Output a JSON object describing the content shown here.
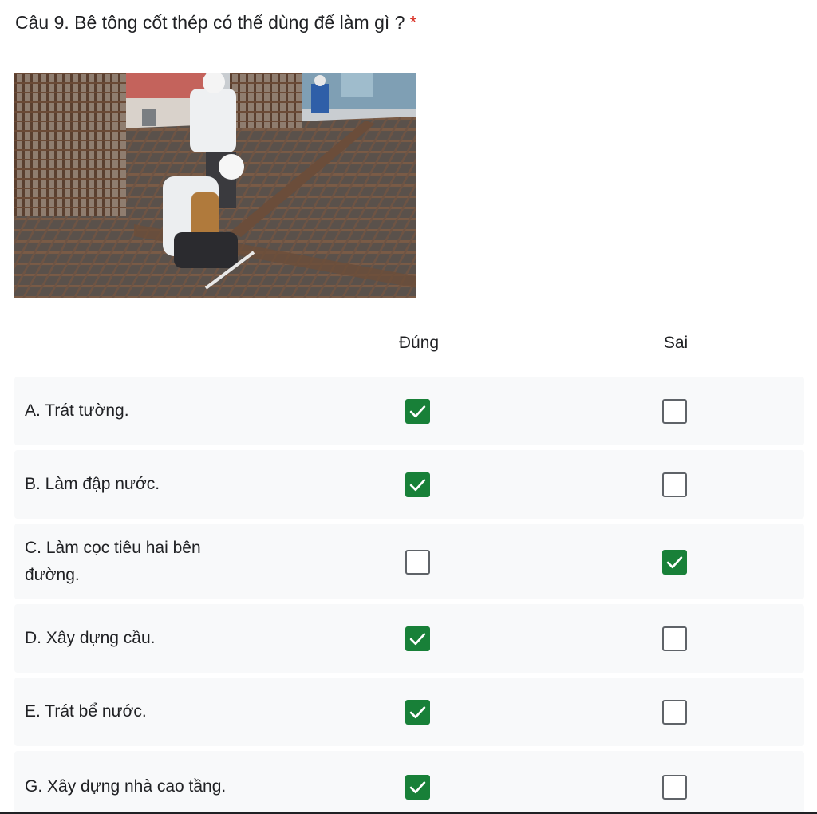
{
  "question": {
    "title": "Câu 9. Bê tông cốt thép có thể dùng để làm gì ?",
    "required_marker": "*",
    "image_alt": "Công nhân đang lắp đặt cốt thép cho sàn bê tông"
  },
  "columns": {
    "dung": "Đúng",
    "sai": "Sai"
  },
  "rows": [
    {
      "label": "A. Trát tường.",
      "dung": true,
      "sai": false
    },
    {
      "label": "B. Làm đập nước.",
      "dung": true,
      "sai": false
    },
    {
      "label": "C. Làm cọc tiêu hai bên đường.",
      "dung": false,
      "sai": true
    },
    {
      "label": "D. Xây dựng cầu.",
      "dung": true,
      "sai": false
    },
    {
      "label": "E. Trát bể nước.",
      "dung": true,
      "sai": false
    },
    {
      "label": "G. Xây dựng nhà cao tầng.",
      "dung": true,
      "sai": false
    }
  ],
  "colors": {
    "checked": "#188038",
    "unchecked_border": "#5f6368",
    "required": "#d93025",
    "row_background": "#f8f9fa"
  },
  "icons": {
    "checked_box": "check-icon",
    "unchecked_box": "empty-checkbox"
  }
}
